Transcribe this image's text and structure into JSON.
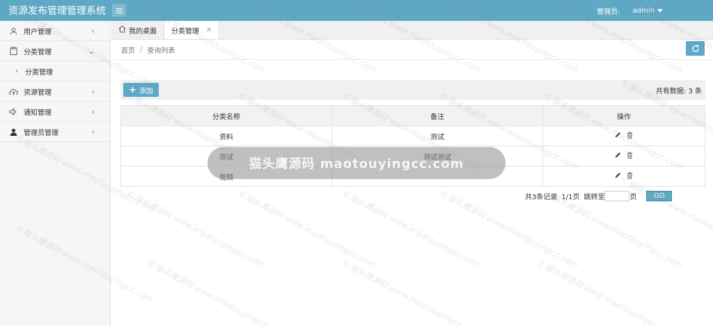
{
  "app": {
    "title": "资源发布管理管理系统"
  },
  "header": {
    "admin_label": "管理员:",
    "admin_name": "admin"
  },
  "sidebar": {
    "items": [
      {
        "label": "用户管理",
        "icon": "user-outline-icon",
        "expanded": false
      },
      {
        "label": "分类管理",
        "icon": "clipboard-icon",
        "expanded": true,
        "children": [
          {
            "label": "分类管理"
          }
        ]
      },
      {
        "label": "资源管理",
        "icon": "cloud-upload-icon",
        "expanded": false
      },
      {
        "label": "通知管理",
        "icon": "speaker-icon",
        "expanded": false
      },
      {
        "label": "管理员管理",
        "icon": "user-filled-icon",
        "expanded": false
      }
    ]
  },
  "tabs": [
    {
      "label": "我的桌面",
      "icon": "home-icon"
    },
    {
      "label": "分类管理",
      "active": true,
      "closable": true
    }
  ],
  "breadcrumb": {
    "items": [
      "首页",
      "查询列表"
    ],
    "separator": "/"
  },
  "toolbar": {
    "add_label": "添加",
    "total_text": "共有数据: 3 条"
  },
  "table": {
    "headers": [
      "分类名称",
      "备注",
      "操作"
    ],
    "rows": [
      {
        "name": "资料",
        "remark": "测试"
      },
      {
        "name": "测试",
        "remark": "测试测试"
      },
      {
        "name": "视频",
        "remark": ""
      }
    ]
  },
  "pagination": {
    "records_text": "共3条记录",
    "page_text": "1/1页",
    "jump_label": "跳转至",
    "page_unit": "页",
    "go_label": "GO"
  },
  "watermark": {
    "text": "©猫头鹰源码 www.maotouyingcc.com",
    "center_text": "猫头鹰源码 maotouyingcc.com"
  },
  "colors": {
    "primary": "#5ea8c6",
    "sidebar_bg": "#f6f6f6",
    "tab_bg": "#f0f0f0"
  }
}
